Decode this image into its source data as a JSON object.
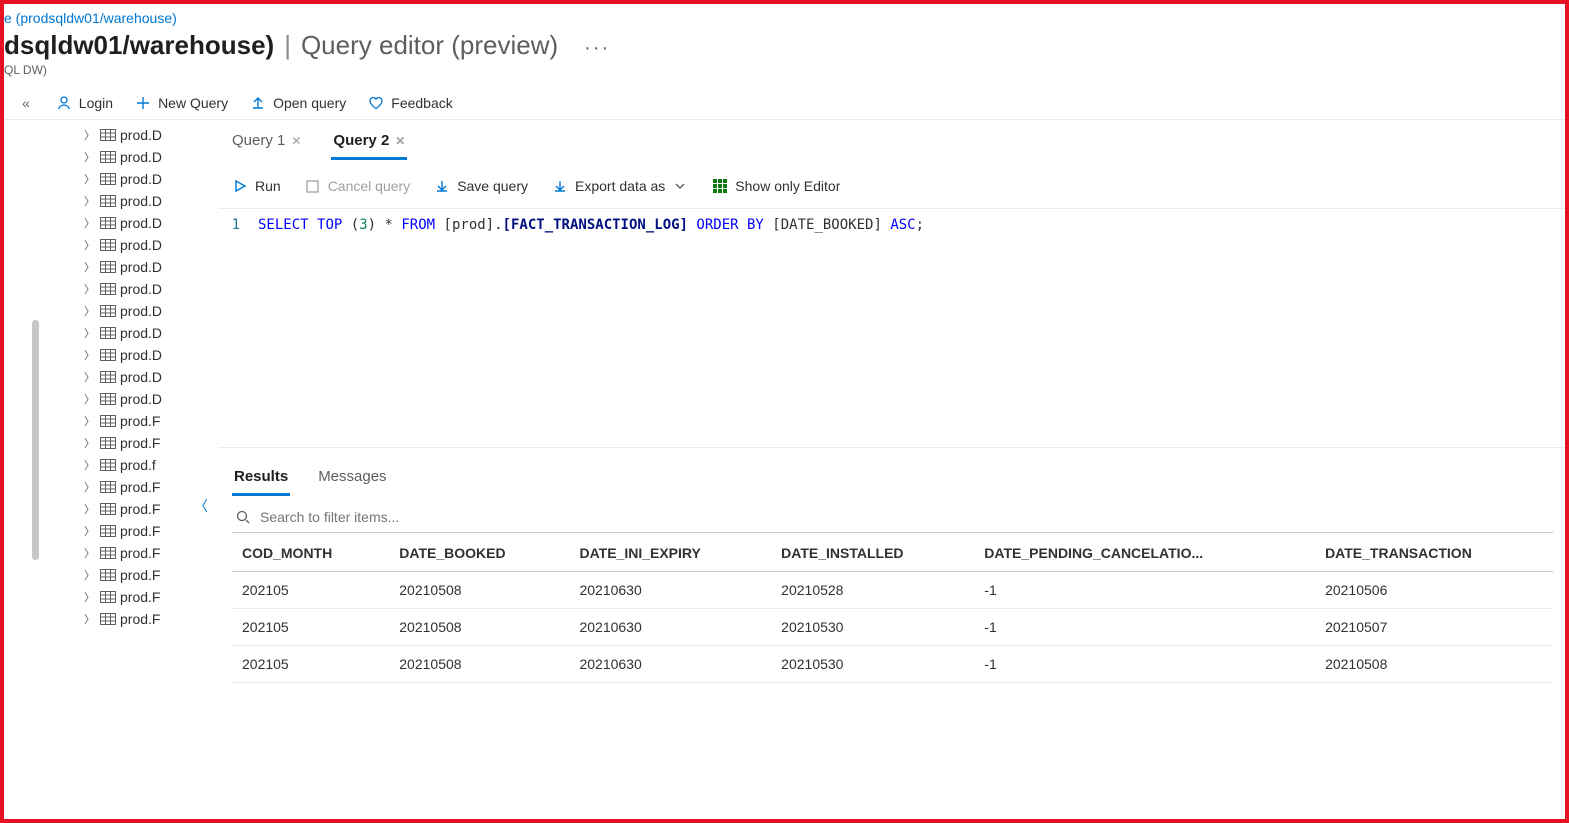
{
  "breadcrumb": "e (prodsqldw01/warehouse)",
  "title_main": "dsqldw01/warehouse)",
  "title_page": "Query editor (preview)",
  "title_more": "···",
  "subtitle": "QL DW)",
  "toolbar": {
    "login": "Login",
    "new_query": "New Query",
    "open_query": "Open query",
    "feedback": "Feedback"
  },
  "sidebar": {
    "items": [
      "prod.D",
      "prod.D",
      "prod.D",
      "prod.D",
      "prod.D",
      "prod.D",
      "prod.D",
      "prod.D",
      "prod.D",
      "prod.D",
      "prod.D",
      "prod.D",
      "prod.D",
      "prod.F",
      "prod.F",
      "prod.f",
      "prod.F",
      "prod.F",
      "prod.F",
      "prod.F",
      "prod.F",
      "prod.F",
      "prod.F"
    ]
  },
  "tabs": [
    {
      "label": "Query 1",
      "active": false
    },
    {
      "label": "Query 2",
      "active": true
    }
  ],
  "query_toolbar": {
    "run": "Run",
    "cancel": "Cancel query",
    "save": "Save query",
    "export": "Export data as",
    "show_only": "Show only Editor"
  },
  "editor": {
    "line_no": "1",
    "tokens": {
      "select": "SELECT",
      "top": "TOP",
      "lp": "(",
      "n": "3",
      "rp": ")",
      "star": "*",
      "from": "FROM",
      "schema": "[prod]",
      "dot": ".",
      "table": "[FACT_TRANSACTION_LOG]",
      "orderby": "ORDER BY",
      "col": "[DATE_BOOKED]",
      "asc": "ASC",
      "semi": ";"
    }
  },
  "results_tabs": {
    "results": "Results",
    "messages": "Messages"
  },
  "search_placeholder": "Search to filter items...",
  "results": {
    "columns": [
      "COD_MONTH",
      "DATE_BOOKED",
      "DATE_INI_EXPIRY",
      "DATE_INSTALLED",
      "DATE_PENDING_CANCELATIO...",
      "DATE_TRANSACTION"
    ],
    "rows": [
      [
        "202105",
        "20210508",
        "20210630",
        "20210528",
        "-1",
        "20210506"
      ],
      [
        "202105",
        "20210508",
        "20210630",
        "20210530",
        "-1",
        "20210507"
      ],
      [
        "202105",
        "20210508",
        "20210630",
        "20210530",
        "-1",
        "20210508"
      ]
    ]
  }
}
